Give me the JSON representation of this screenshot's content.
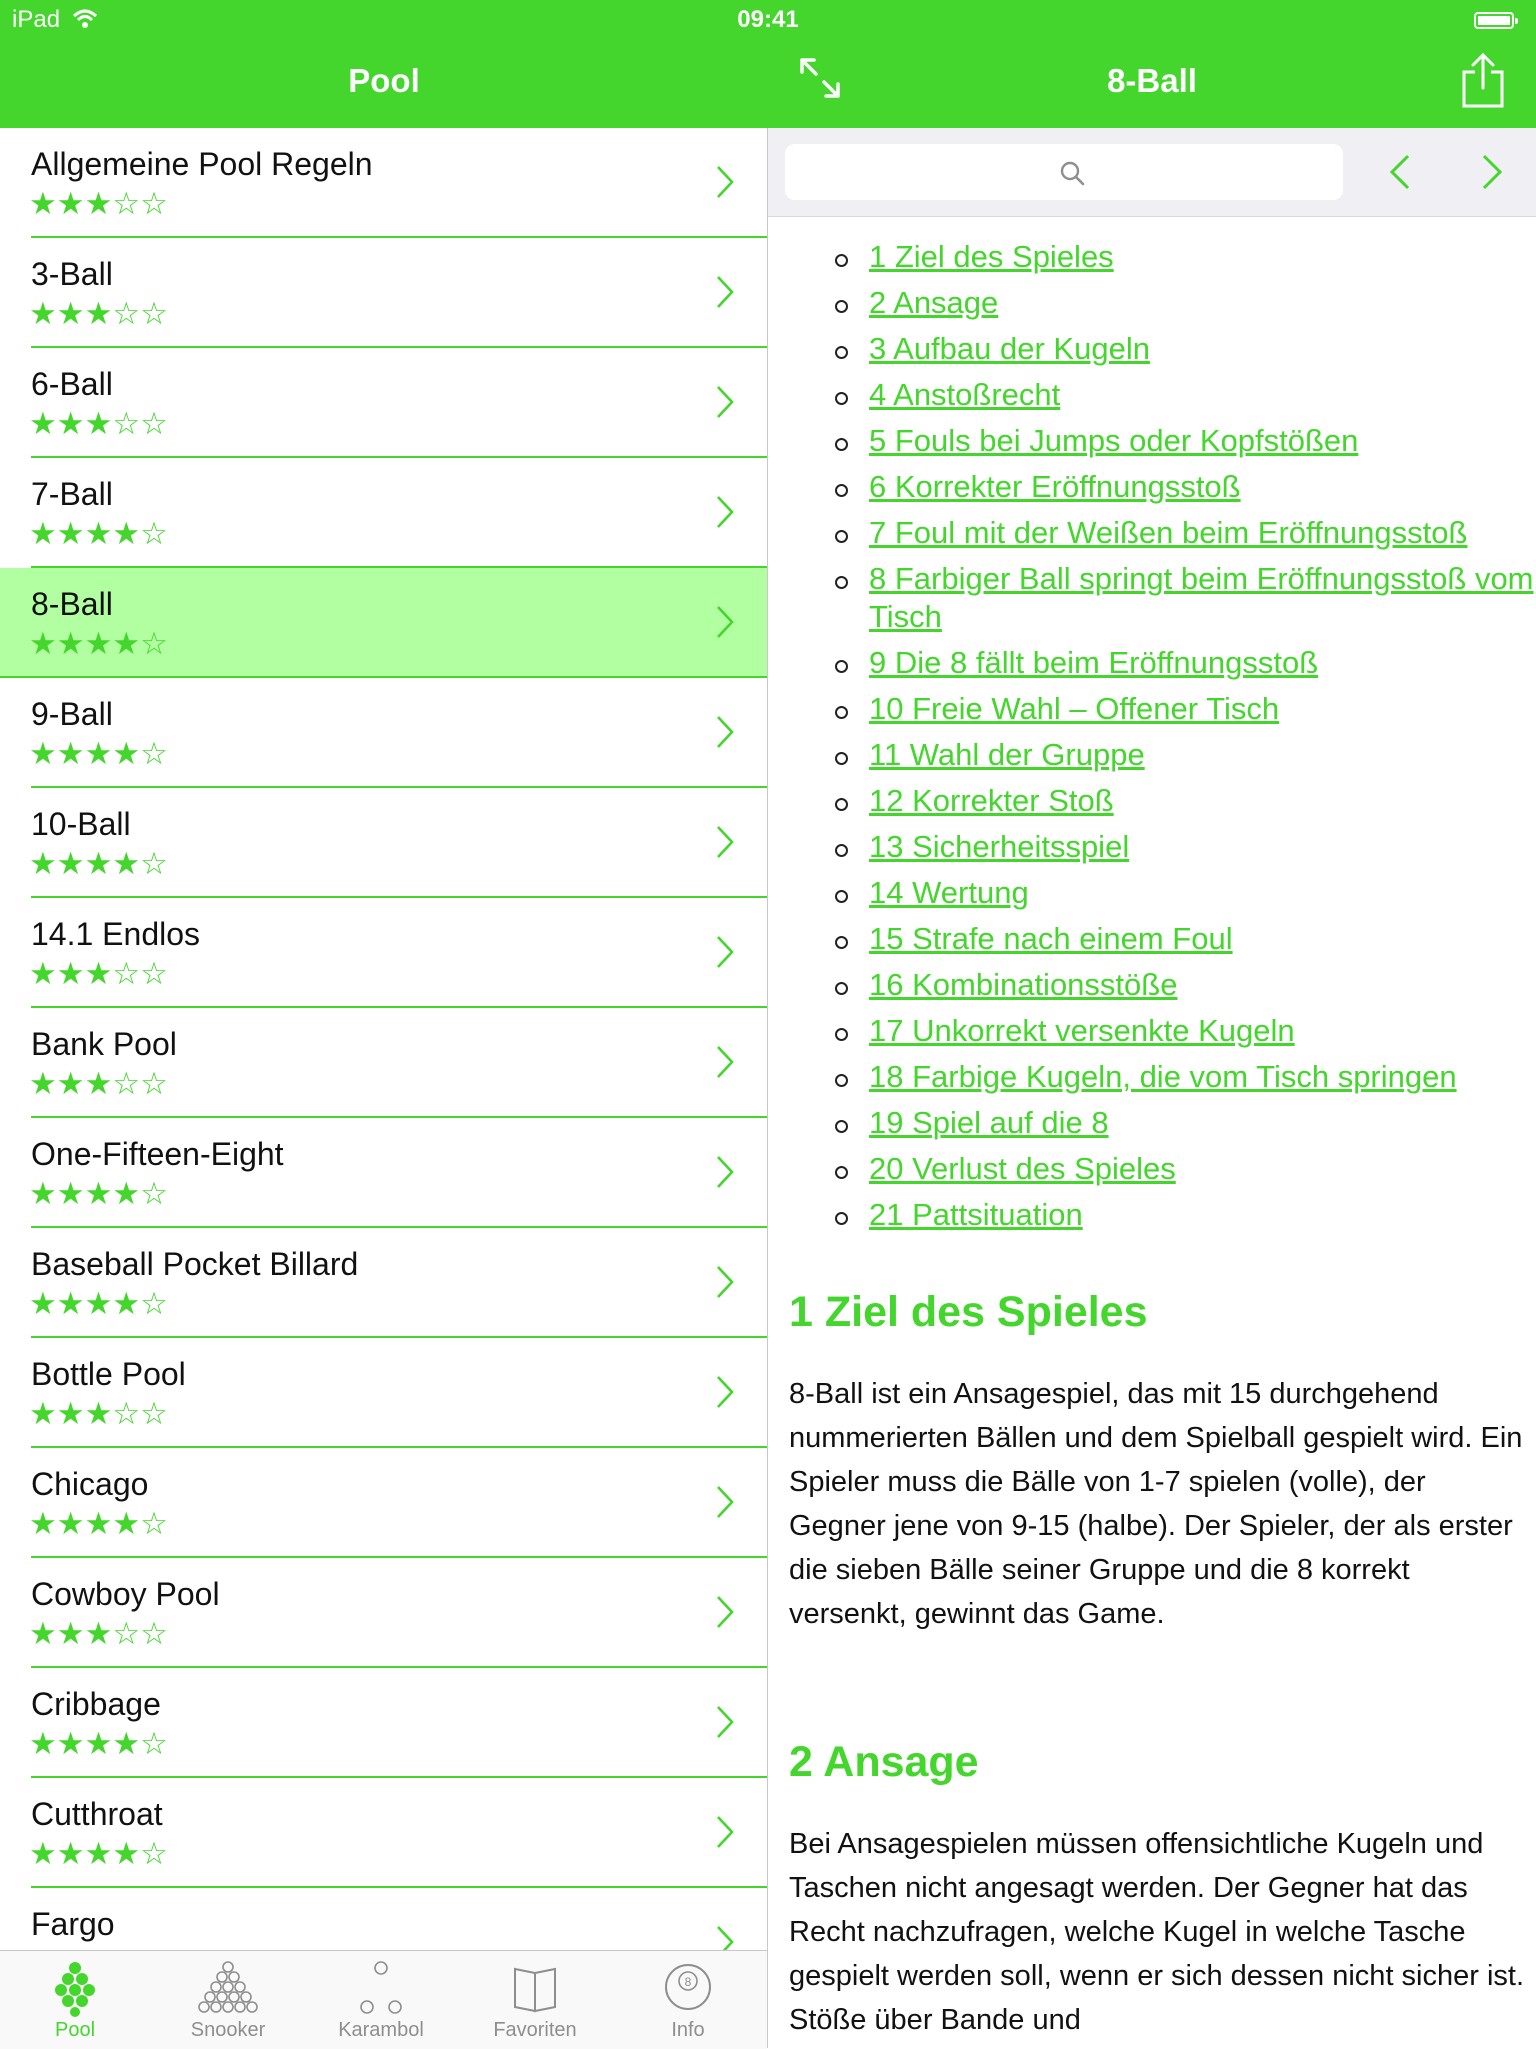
{
  "status_bar": {
    "carrier": "iPad",
    "time": "09:41"
  },
  "master": {
    "title": "Pool",
    "items": [
      {
        "name": "Allgemeine Pool Regeln",
        "stars": "★★★☆☆"
      },
      {
        "name": "3-Ball",
        "stars": "★★★☆☆"
      },
      {
        "name": "6-Ball",
        "stars": "★★★☆☆"
      },
      {
        "name": "7-Ball",
        "stars": "★★★★☆"
      },
      {
        "name": "8-Ball",
        "stars": "★★★★☆",
        "selected": true
      },
      {
        "name": "9-Ball",
        "stars": "★★★★☆"
      },
      {
        "name": "10-Ball",
        "stars": "★★★★☆"
      },
      {
        "name": "14.1 Endlos",
        "stars": "★★★☆☆"
      },
      {
        "name": "Bank Pool",
        "stars": "★★★☆☆"
      },
      {
        "name": "One-Fifteen-Eight",
        "stars": "★★★★☆"
      },
      {
        "name": "Baseball Pocket Billard",
        "stars": "★★★★☆"
      },
      {
        "name": "Bottle Pool",
        "stars": "★★★☆☆"
      },
      {
        "name": "Chicago",
        "stars": "★★★★☆"
      },
      {
        "name": "Cowboy Pool",
        "stars": "★★★☆☆"
      },
      {
        "name": "Cribbage",
        "stars": "★★★★☆"
      },
      {
        "name": "Cutthroat",
        "stars": "★★★★☆"
      },
      {
        "name": "Fargo",
        "stars": "★★★☆☆"
      }
    ]
  },
  "tabbar": {
    "tabs": [
      {
        "label": "Pool",
        "icon": "pool-rack-icon",
        "active": true
      },
      {
        "label": "Snooker",
        "icon": "snooker-rack-icon"
      },
      {
        "label": "Karambol",
        "icon": "carom-balls-icon"
      },
      {
        "label": "Favoriten",
        "icon": "book-icon"
      },
      {
        "label": "Info",
        "icon": "eight-ball-icon"
      }
    ]
  },
  "detail": {
    "title": "8-Ball",
    "search": {
      "placeholder": ""
    },
    "toc": [
      "1 Ziel des Spieles",
      "2 Ansage",
      "3 Aufbau der Kugeln",
      "4 Anstoßrecht",
      "5 Fouls bei Jumps oder Kopfstößen",
      "6 Korrekter Eröffnungsstoß",
      "7 Foul mit der Weißen beim Eröffnungsstoß",
      "8 Farbiger Ball springt beim Eröffnungsstoß vom Tisch",
      "9 Die 8 fällt beim Eröffnungsstoß",
      "10 Freie Wahl – Offener Tisch",
      "11 Wahl der Gruppe",
      "12 Korrekter Stoß",
      "13 Sicherheitsspiel",
      "14 Wertung",
      "15 Strafe nach einem Foul",
      "16 Kombinationsstöße",
      "17 Unkorrekt versenkte Kugeln",
      "18 Farbige Kugeln, die vom Tisch springen",
      "19 Spiel auf die 8",
      "20 Verlust des Spieles",
      "21 Pattsituation"
    ],
    "sections": [
      {
        "heading": "1 Ziel des Spieles",
        "text": "8-Ball ist ein Ansagespiel, das mit 15 durchgehend nummerierten Bällen und dem Spielball gespielt wird. Ein Spieler muss die Bälle von 1-7 spielen (volle), der Gegner jene von 9-15 (halbe). Der Spieler, der als erster die sieben Bälle seiner Gruppe und die 8 korrekt versenkt, gewinnt das Game."
      },
      {
        "heading": "2 Ansage",
        "text": "Bei Ansagespielen müssen offensichtliche Kugeln und Taschen nicht angesagt werden. Der Gegner hat das Recht nachzufragen, welche Kugel in welche Tasche gespielt werden soll, wenn er sich dessen nicht sicher ist. Stöße über Bande und"
      }
    ]
  },
  "colors": {
    "accent": "#44d62c",
    "selected_row": "#b2ffa2",
    "tab_inactive": "#8e8e8e"
  }
}
